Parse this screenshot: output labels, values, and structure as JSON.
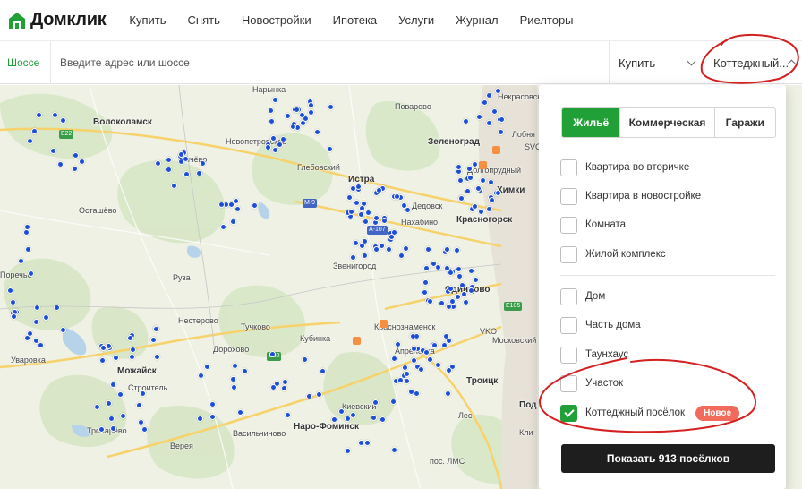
{
  "brand": {
    "name": "Домклик",
    "color": "#21a038"
  },
  "nav": {
    "items": [
      "Купить",
      "Снять",
      "Новостройки",
      "Ипотека",
      "Услуги",
      "Журнал",
      "Риелторы"
    ]
  },
  "search": {
    "highway_link": "Шоссе",
    "placeholder": "Введите адрес или шоссе",
    "deal_type": "Купить",
    "property_type": "Коттеджный..."
  },
  "filter_panel": {
    "segments": [
      {
        "label": "Жильё",
        "active": true
      },
      {
        "label": "Коммерческая",
        "active": false
      },
      {
        "label": "Гаражи",
        "active": false
      }
    ],
    "options_group1": [
      {
        "label": "Квартира во вторичке",
        "checked": false
      },
      {
        "label": "Квартира в новостройке",
        "checked": false
      },
      {
        "label": "Комната",
        "checked": false
      },
      {
        "label": "Жилой комплекс",
        "checked": false
      }
    ],
    "options_group2": [
      {
        "label": "Дом",
        "checked": false
      },
      {
        "label": "Часть дома",
        "checked": false
      },
      {
        "label": "Таунхаус",
        "checked": false
      },
      {
        "label": "Участок",
        "checked": false
      },
      {
        "label": "Коттеджный посёлок",
        "checked": true,
        "badge": "Новое"
      }
    ],
    "show_button": "Показать 913 посёлков"
  },
  "map": {
    "places": {
      "narynka": "Нарынка",
      "nekrasovsky": "Некрасовский",
      "volokolamsk": "Волоколамск",
      "povarovo": "Поварово",
      "zelenograd": "Зеленоград",
      "lobnya": "Лобня",
      "svo": "SVO",
      "dolgoprudny": "Долгопрудный",
      "khimki": "Химки",
      "novopetrovskoe": "Новопетровское",
      "sychevo": "Сычёво",
      "glebovsky": "Глебовский",
      "istra": "Истра",
      "dedovsk": "Дедовск",
      "nakhabino": "Нахабино",
      "krasnogorsk": "Красногорск",
      "ostashevo": "Осташёво",
      "zvenigorod": "Звенигород",
      "odintsovo": "Одинцово",
      "poreche": "Поречье",
      "ruza": "Руза",
      "nesterovo": "Нестерово",
      "tuchkovo": "Тучково",
      "kubinka": "Кубинка",
      "krasnoznamensk": "Краснознаменск",
      "vko": "VKO",
      "moskovsky": "Московский",
      "uvarovka": "Уваровка",
      "mozhaisk": "Можайск",
      "dorokhovo": "Дорохово",
      "aprelevka": "Апрелевка",
      "stroitel": "Строитель",
      "troitsk": "Троицк",
      "kievsky": "Киевский",
      "podolsk": "Под",
      "tropareevo": "Тропарёво",
      "vereya": "Верея",
      "vasilchinovo": "Васильчиново",
      "naro_fominsk": "Наро-Фоминск",
      "lesnoy": "Лес",
      "lms": "пос. ЛМС",
      "klimovsk": "Кли"
    },
    "roads": {
      "e22": "E22",
      "m9": "M-9",
      "a107": "A-107",
      "e30": "E30",
      "e105": "E105"
    }
  },
  "colors": {
    "accent": "#21a038",
    "dot": "#1d4ed8",
    "badge_new": "#f26a5b",
    "annotation": "#d42020"
  }
}
